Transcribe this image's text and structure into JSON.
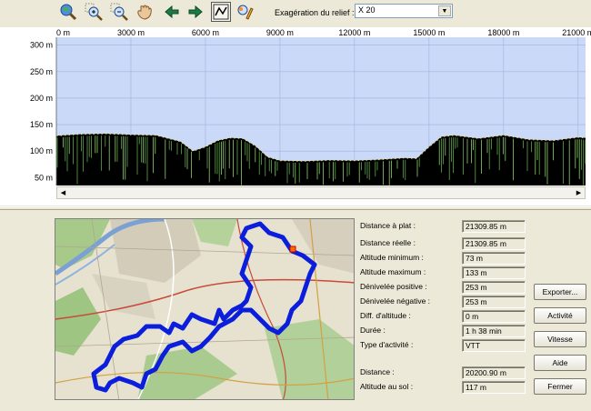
{
  "toolbar": {
    "relief_label": "Exagération du relief :",
    "relief_value": "X 20",
    "icons": [
      "zoom-globe",
      "zoom-in",
      "zoom-out",
      "pan-hand",
      "arrow-left",
      "arrow-right",
      "profile-mode",
      "edit-pencil"
    ]
  },
  "profile": {
    "x_ticks": [
      "0 m",
      "3000 m",
      "6000 m",
      "9000 m",
      "12000 m",
      "15000 m",
      "18000 m",
      "21000 m"
    ],
    "y_ticks": [
      "300 m",
      "250 m",
      "200 m",
      "150 m",
      "100 m",
      "50 m"
    ],
    "colors": {
      "sky": "#c9d9f7",
      "ground": "#000000",
      "grass": "#5fa64a",
      "ridge": "#f1e070"
    }
  },
  "chart_data": {
    "type": "area",
    "title": "",
    "xlabel": "",
    "ylabel": "",
    "xlim": [
      0,
      21300
    ],
    "ylim": [
      35,
      315
    ],
    "x": [
      0,
      1000,
      2000,
      3000,
      4000,
      5000,
      5500,
      6000,
      6500,
      7000,
      7500,
      8000,
      8500,
      9000,
      10000,
      11000,
      12000,
      13000,
      14000,
      14500,
      15000,
      15500,
      16000,
      17000,
      18000,
      19000,
      20000,
      21000,
      21300
    ],
    "y": [
      129,
      132,
      133,
      131,
      130,
      118,
      100,
      108,
      120,
      125,
      124,
      110,
      89,
      82,
      81,
      83,
      82,
      84,
      87,
      86,
      108,
      127,
      130,
      124,
      130,
      122,
      120,
      126,
      125
    ]
  },
  "stats": {
    "labels": [
      "Distance à plat :",
      "Distance réelle :",
      "Altitude minimum :",
      "Altitude maximum :",
      "Dénivelée positive :",
      "Dénivelée négative :",
      "Diff. d'altitude :",
      "Durée :",
      "Type d'activité :",
      "Distance :",
      "Altitude au sol :"
    ],
    "values": [
      "21309.85 m",
      "21309.85 m",
      "73 m",
      "133 m",
      "253 m",
      "253 m",
      "0 m",
      "1 h 38 min",
      "VTT",
      "20200.90 m",
      "117 m"
    ]
  },
  "buttons": {
    "export": "Exporter...",
    "activity": "Activité",
    "speed": "Vitesse",
    "help": "Aide",
    "close": "Fermer"
  },
  "map": {
    "track_color": "#0a1edc",
    "marker_color": "#ff6a00"
  }
}
